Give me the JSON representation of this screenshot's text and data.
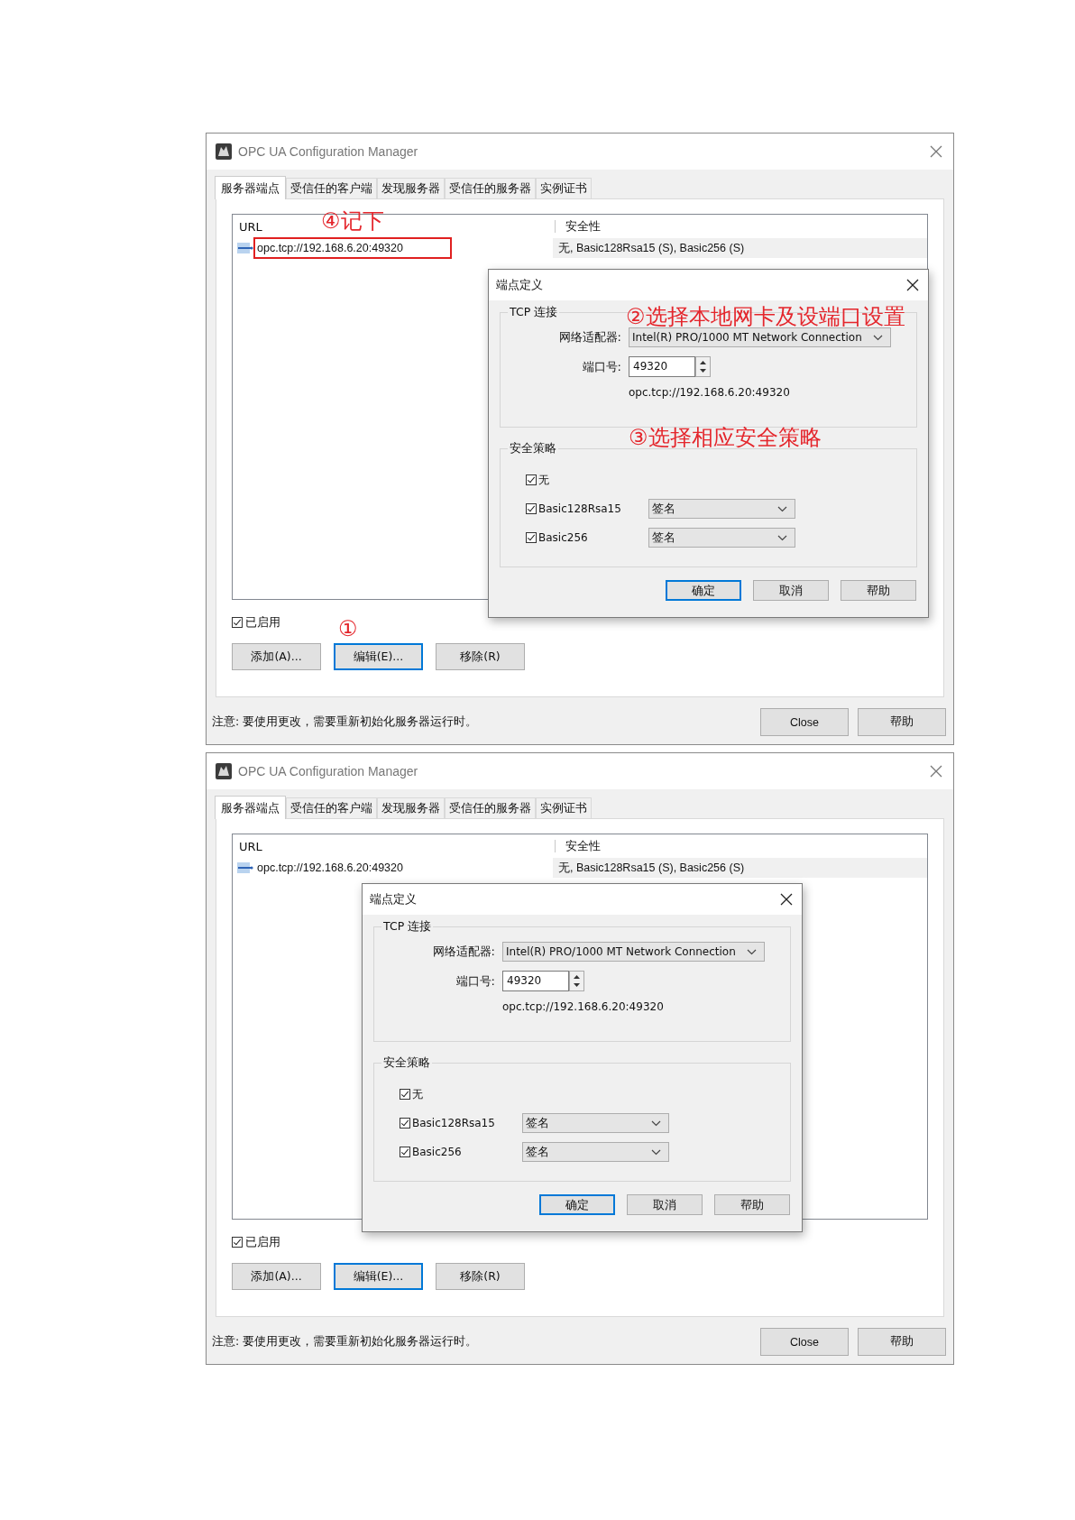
{
  "screenshots": [
    {
      "window": {
        "title": "OPC UA Configuration Manager"
      },
      "tabs": [
        {
          "label": "服务器端点",
          "selected": true
        },
        {
          "label": "受信任的客户端",
          "selected": false
        },
        {
          "label": "发现服务器",
          "selected": false
        },
        {
          "label": "受信任的服务器",
          "selected": false
        },
        {
          "label": "实例证书",
          "selected": false
        }
      ],
      "list": {
        "columns": [
          "URL",
          "安全性"
        ],
        "rows": [
          {
            "url": "opc.tcp://192.168.6.20:49320",
            "security": "无, Basic128Rsa15 (S), Basic256 (S)",
            "marked": true
          }
        ]
      },
      "enabled": {
        "label": "已启用",
        "checked": true
      },
      "buttons": [
        {
          "label": "添加(A)...",
          "focused": false
        },
        {
          "label": "编辑(E)...",
          "focused": true
        },
        {
          "label": "移除(R)",
          "focused": false
        }
      ],
      "note": "注意: 要使用更改，需要重新初始化服务器运行时。",
      "footer_buttons": [
        "Close",
        "帮助"
      ],
      "dialog": {
        "title": "端点定义",
        "tcp_group": "TCP 连接",
        "adapter_label": "网络适配器:",
        "adapter_value": "Intel(R) PRO/1000 MT Network Connection",
        "port_label": "端口号:",
        "port_value": "49320",
        "endpoint_url": "opc.tcp://192.168.6.20:49320",
        "security_group": "安全策略",
        "policies": [
          {
            "kind": "plain",
            "label": "无",
            "checked": true
          },
          {
            "kind": "mode",
            "label": "Basic128Rsa15",
            "checked": true,
            "mode": "签名"
          },
          {
            "kind": "mode",
            "label": "Basic256",
            "checked": true,
            "mode": "签名"
          }
        ],
        "buttons": [
          {
            "label": "确定",
            "default": true
          },
          {
            "label": "取消",
            "default": false
          },
          {
            "label": "帮助",
            "default": false
          }
        ]
      },
      "annotations": [
        {
          "kind": "url",
          "text": "④记下"
        },
        {
          "kind": "adapter",
          "text": "②选择本地网卡及设端口设置"
        },
        {
          "kind": "policy",
          "text": "③选择相应安全策略"
        },
        {
          "kind": "edit",
          "text": "①"
        }
      ]
    },
    {
      "window": {
        "title": "OPC UA Configuration Manager"
      },
      "tabs": [
        {
          "label": "服务器端点",
          "selected": true
        },
        {
          "label": "受信任的客户端",
          "selected": false
        },
        {
          "label": "发现服务器",
          "selected": false
        },
        {
          "label": "受信任的服务器",
          "selected": false
        },
        {
          "label": "实例证书",
          "selected": false
        }
      ],
      "list": {
        "columns": [
          "URL",
          "安全性"
        ],
        "rows": [
          {
            "url": "opc.tcp://192.168.6.20:49320",
            "security": "无, Basic128Rsa15 (S), Basic256 (S)",
            "marked": false
          }
        ]
      },
      "enabled": {
        "label": "已启用",
        "checked": true
      },
      "buttons": [
        {
          "label": "添加(A)...",
          "focused": false
        },
        {
          "label": "编辑(E)...",
          "focused": true
        },
        {
          "label": "移除(R)",
          "focused": false
        }
      ],
      "note": "注意: 要使用更改，需要重新初始化服务器运行时。",
      "footer_buttons": [
        "Close",
        "帮助"
      ],
      "dialog": {
        "title": "端点定义",
        "tcp_group": "TCP 连接",
        "adapter_label": "网络适配器:",
        "adapter_value": "Intel(R) PRO/1000 MT Network Connection",
        "port_label": "端口号:",
        "port_value": "49320",
        "endpoint_url": "opc.tcp://192.168.6.20:49320",
        "security_group": "安全策略",
        "policies": [
          {
            "kind": "plain",
            "label": "无",
            "checked": true
          },
          {
            "kind": "mode",
            "label": "Basic128Rsa15",
            "checked": true,
            "mode": "签名"
          },
          {
            "kind": "mode",
            "label": "Basic256",
            "checked": true,
            "mode": "签名"
          }
        ],
        "buttons": [
          {
            "label": "确定",
            "default": true
          },
          {
            "label": "取消",
            "default": false
          },
          {
            "label": "帮助",
            "default": false
          }
        ]
      }
    }
  ]
}
